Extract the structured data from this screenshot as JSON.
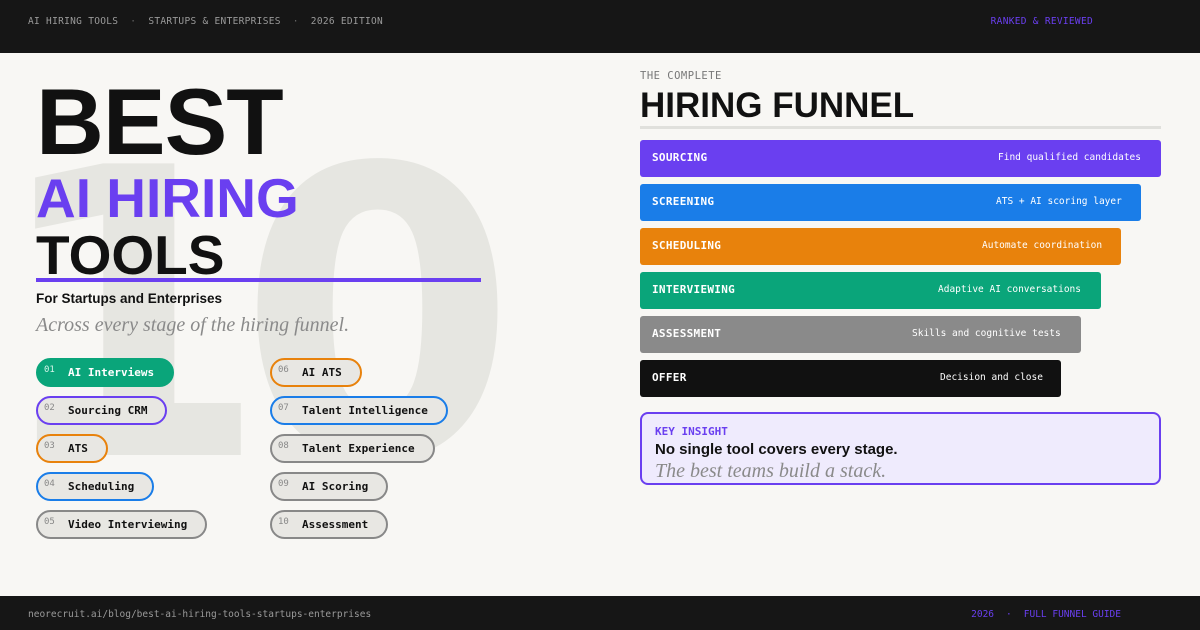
{
  "topbar": {
    "items": [
      "AI HIRING TOOLS",
      "STARTUPS & ENTERPRISES",
      "2026 EDITION"
    ],
    "separator": "·",
    "right": "RANKED & REVIEWED"
  },
  "hero": {
    "watermark_number": "10",
    "line1": "BEST",
    "line2": "AI HIRING",
    "line3": "TOOLS",
    "subtitle": "For Startups and Enterprises",
    "tagline": "Across every stage of the hiring funnel.",
    "accent_color": "#6a3ff0"
  },
  "tools": [
    {
      "num": "01",
      "label": "AI Interviews",
      "color": "#0aa57a",
      "filled": true
    },
    {
      "num": "02",
      "label": "Sourcing CRM",
      "color": "#6a3ff0",
      "filled": false
    },
    {
      "num": "03",
      "label": "ATS",
      "color": "#e8820c",
      "filled": false
    },
    {
      "num": "04",
      "label": "Scheduling",
      "color": "#1a7de8",
      "filled": false
    },
    {
      "num": "05",
      "label": "Video Interviewing",
      "color": "#888888",
      "filled": false
    },
    {
      "num": "06",
      "label": "AI ATS",
      "color": "#e8820c",
      "filled": false
    },
    {
      "num": "07",
      "label": "Talent Intelligence",
      "color": "#1a7de8",
      "filled": false
    },
    {
      "num": "08",
      "label": "Talent Experience",
      "color": "#888888",
      "filled": false
    },
    {
      "num": "09",
      "label": "AI Scoring",
      "color": "#888888",
      "filled": false
    },
    {
      "num": "10",
      "label": "Assessment",
      "color": "#888888",
      "filled": false
    }
  ],
  "funnel": {
    "kicker": "THE COMPLETE",
    "title": "HIRING FUNNEL",
    "stages": [
      {
        "name": "SOURCING",
        "desc": "Find qualified candidates",
        "color": "#6a3ff0"
      },
      {
        "name": "SCREENING",
        "desc": "ATS + AI scoring layer",
        "color": "#1a7de8"
      },
      {
        "name": "SCHEDULING",
        "desc": "Automate coordination",
        "color": "#e8820c"
      },
      {
        "name": "INTERVIEWING",
        "desc": "Adaptive AI conversations",
        "color": "#0aa57a"
      },
      {
        "name": "ASSESSMENT",
        "desc": "Skills and cognitive tests",
        "color": "#8a8a8a"
      },
      {
        "name": "OFFER",
        "desc": "Decision and close",
        "color": "#111111"
      }
    ]
  },
  "insight": {
    "kicker": "KEY INSIGHT",
    "headline": "No single tool covers every stage.",
    "tagline": "The best teams build a stack."
  },
  "footer": {
    "url": "neorecruit.ai/blog/best-ai-hiring-tools-startups-enterprises",
    "year": "2026",
    "separator": "·",
    "guide": "FULL FUNNEL GUIDE"
  }
}
